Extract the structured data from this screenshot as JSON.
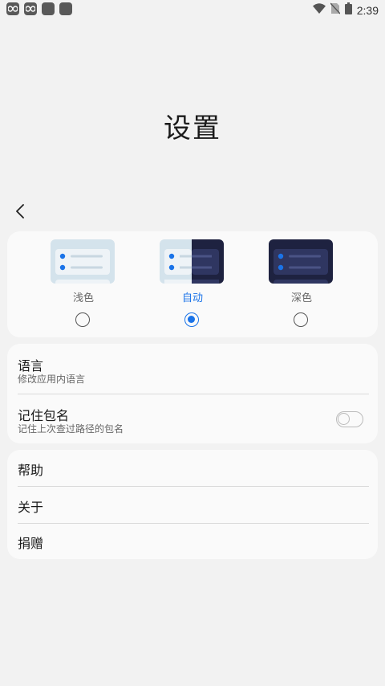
{
  "status_bar": {
    "time": "2:39",
    "left_icons": [
      "infinity-app-icon",
      "infinity-app-icon",
      "app-square-icon",
      "app-square-icon"
    ],
    "right_icons": [
      "wifi-icon",
      "no-sim-icon",
      "battery-icon"
    ]
  },
  "page": {
    "title": "设置",
    "back_icon": "chevron-left-icon"
  },
  "theme": {
    "options": [
      {
        "label": "浅色",
        "selected": false
      },
      {
        "label": "自动",
        "selected": true
      },
      {
        "label": "深色",
        "selected": false
      }
    ],
    "colors": {
      "accent": "#1a73e8",
      "light_thumb": "#d4e3ec",
      "dark_thumb": "#1e2240"
    }
  },
  "preferences": {
    "language": {
      "title": "语言",
      "subtitle": "修改应用内语言"
    },
    "remember_package": {
      "title": "记住包名",
      "subtitle": "记住上次查过路径的包名",
      "enabled": false
    }
  },
  "misc": {
    "help": "帮助",
    "about": "关于",
    "donate": "捐赠"
  }
}
